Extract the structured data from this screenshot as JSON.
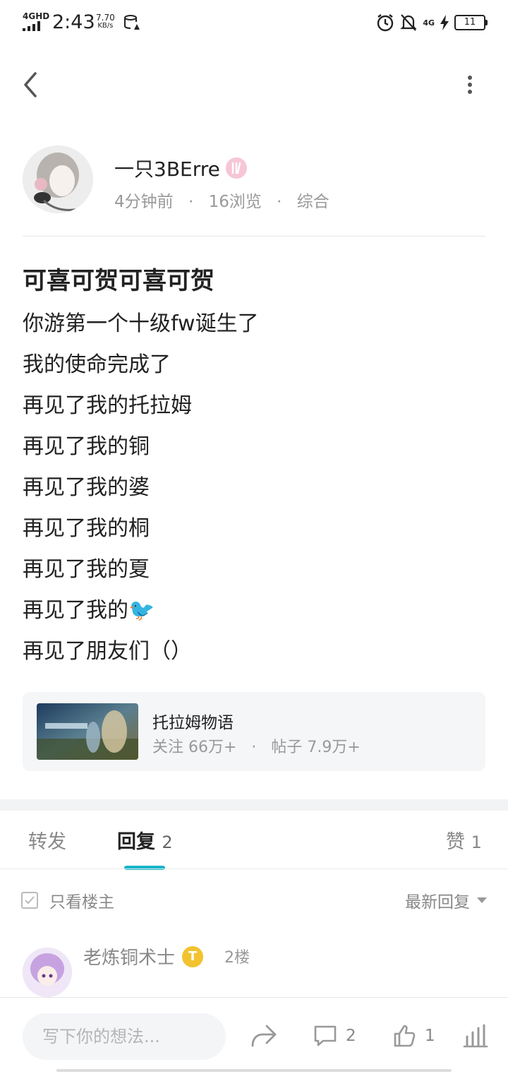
{
  "status_bar": {
    "network": "4GHD",
    "time": "2:43",
    "speed_value": "7.70",
    "speed_unit": "KB/s",
    "network_right": "4G",
    "battery": "11"
  },
  "author": {
    "name": "一只3BErre",
    "time_ago": "4分钟前",
    "views": "16浏览",
    "category": "综合",
    "separator": "·"
  },
  "post": {
    "title": "可喜可贺可喜可贺",
    "lines": [
      "你游第一个十级fw诞生了",
      "我的使命完成了",
      "再见了我的托拉姆",
      "再见了我的铜",
      "再见了我的婆",
      "再见了我的桐",
      "再见了我的夏",
      "再见了我的",
      "再见了朋友们（）"
    ],
    "bird_emoji": "🐦"
  },
  "forum": {
    "name": "托拉姆物语",
    "followers": "关注 66万+",
    "posts": "帖子 7.9万+",
    "separator": "·"
  },
  "tabs": {
    "repost": "转发",
    "reply": "回复",
    "reply_count": "2",
    "like": "赞",
    "like_count": "1"
  },
  "filter": {
    "only_op": "只看楼主",
    "sort": "最新回复"
  },
  "reply_preview": {
    "name": "老炼铜术士",
    "level_badge": "T",
    "floor": "2楼"
  },
  "bottom_bar": {
    "placeholder": "写下你的想法...",
    "reply_count": "2",
    "like_count": "1"
  },
  "colors": {
    "accent": "#1ab5c8",
    "text_primary": "#222222",
    "text_secondary": "#999999",
    "card_bg": "#f4f6f8"
  }
}
